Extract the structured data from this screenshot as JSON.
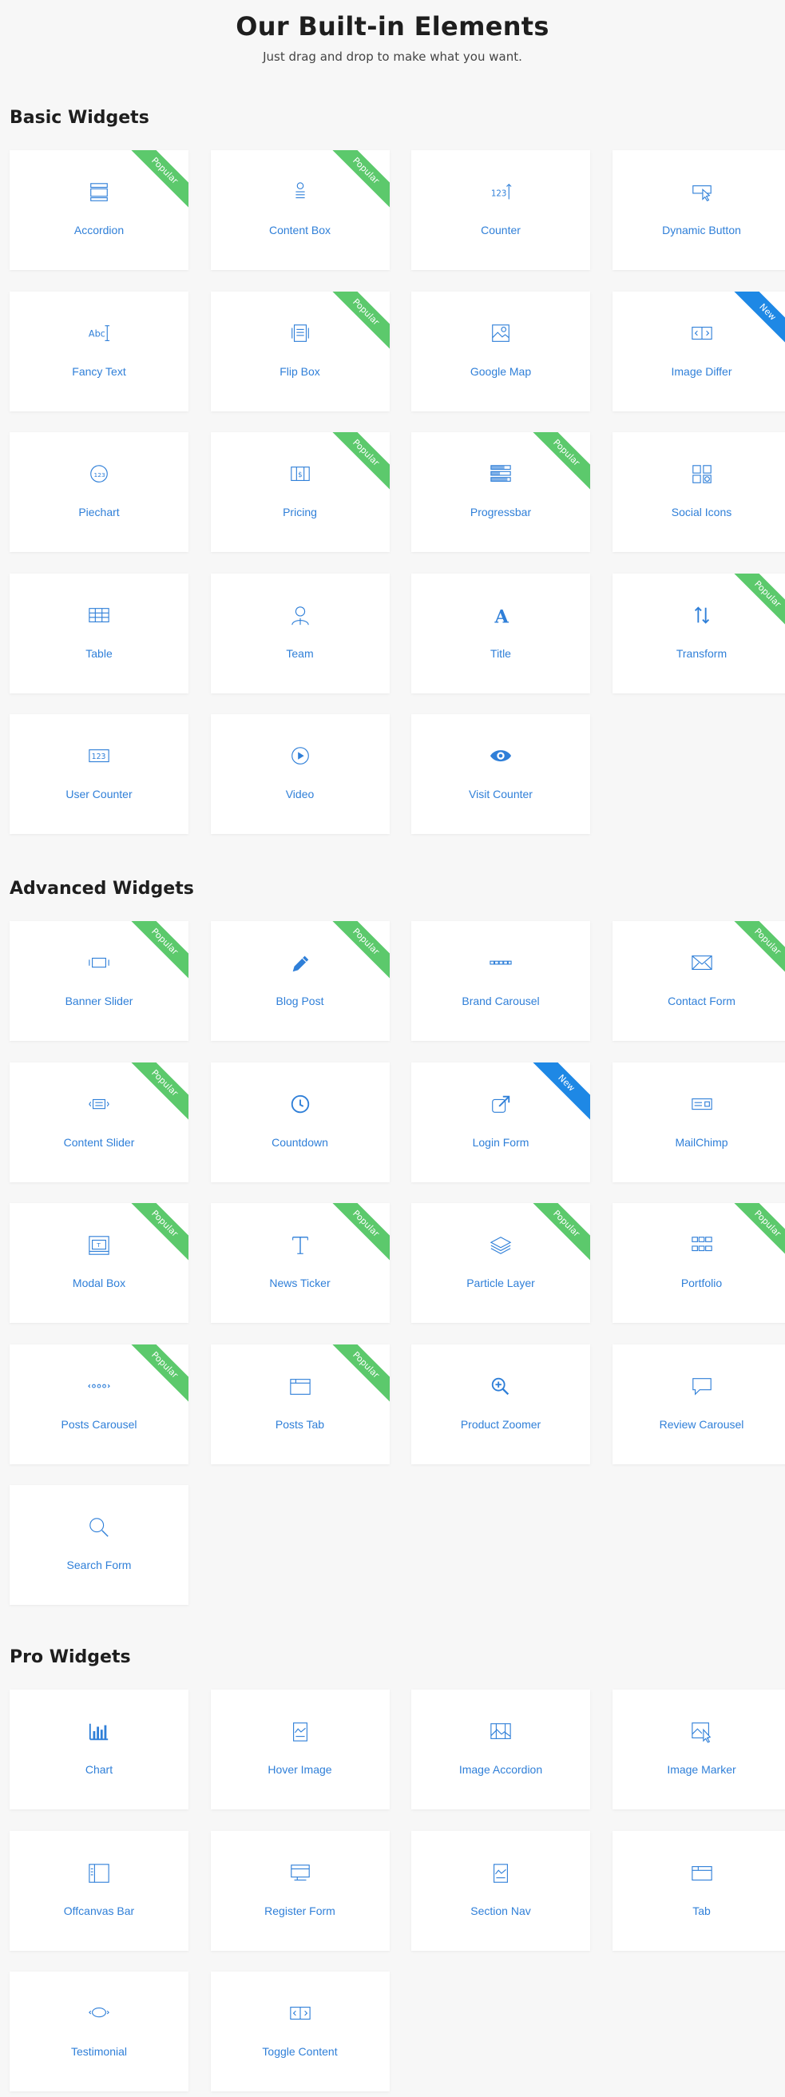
{
  "header": {
    "title": "Our Built-in Elements",
    "subtitle": "Just drag and drop to make what you want."
  },
  "colors": {
    "accent": "#2f7fd8",
    "popular": "#5cc96c",
    "new": "#1e88e5"
  },
  "sections": [
    {
      "title": "Basic Widgets",
      "items": [
        {
          "label": "Accordion",
          "icon": "accordion-icon",
          "badge": "Popular"
        },
        {
          "label": "Content Box",
          "icon": "content-box-icon",
          "badge": "Popular"
        },
        {
          "label": "Counter",
          "icon": "counter-icon",
          "badge": ""
        },
        {
          "label": "Dynamic Button",
          "icon": "dynamic-button-icon",
          "badge": ""
        },
        {
          "label": "Fancy Text",
          "icon": "fancy-text-icon",
          "badge": ""
        },
        {
          "label": "Flip Box",
          "icon": "flip-box-icon",
          "badge": "Popular"
        },
        {
          "label": "Google Map",
          "icon": "google-map-icon",
          "badge": ""
        },
        {
          "label": "Image Differ",
          "icon": "image-differ-icon",
          "badge": "New"
        },
        {
          "label": "Piechart",
          "icon": "piechart-icon",
          "badge": ""
        },
        {
          "label": "Pricing",
          "icon": "pricing-icon",
          "badge": "Popular"
        },
        {
          "label": "Progressbar",
          "icon": "progressbar-icon",
          "badge": "Popular"
        },
        {
          "label": "Social Icons",
          "icon": "social-icons-icon",
          "badge": ""
        },
        {
          "label": "Table",
          "icon": "table-icon",
          "badge": ""
        },
        {
          "label": "Team",
          "icon": "team-icon",
          "badge": ""
        },
        {
          "label": "Title",
          "icon": "title-icon",
          "badge": ""
        },
        {
          "label": "Transform",
          "icon": "transform-icon",
          "badge": "Popular"
        },
        {
          "label": "User Counter",
          "icon": "user-counter-icon",
          "badge": ""
        },
        {
          "label": "Video",
          "icon": "video-icon",
          "badge": ""
        },
        {
          "label": "Visit Counter",
          "icon": "visit-counter-icon",
          "badge": ""
        }
      ]
    },
    {
      "title": "Advanced Widgets",
      "items": [
        {
          "label": "Banner Slider",
          "icon": "banner-slider-icon",
          "badge": "Popular"
        },
        {
          "label": "Blog Post",
          "icon": "blog-post-icon",
          "badge": "Popular"
        },
        {
          "label": "Brand Carousel",
          "icon": "brand-carousel-icon",
          "badge": ""
        },
        {
          "label": "Contact Form",
          "icon": "contact-form-icon",
          "badge": "Popular"
        },
        {
          "label": "Content Slider",
          "icon": "content-slider-icon",
          "badge": "Popular"
        },
        {
          "label": "Countdown",
          "icon": "countdown-icon",
          "badge": ""
        },
        {
          "label": "Login Form",
          "icon": "login-form-icon",
          "badge": "New"
        },
        {
          "label": "MailChimp",
          "icon": "mailchimp-icon",
          "badge": ""
        },
        {
          "label": "Modal Box",
          "icon": "modal-box-icon",
          "badge": "Popular"
        },
        {
          "label": "News Ticker",
          "icon": "news-ticker-icon",
          "badge": "Popular"
        },
        {
          "label": "Particle Layer",
          "icon": "particle-layer-icon",
          "badge": "Popular"
        },
        {
          "label": "Portfolio",
          "icon": "portfolio-icon",
          "badge": "Popular"
        },
        {
          "label": "Posts Carousel",
          "icon": "posts-carousel-icon",
          "badge": "Popular"
        },
        {
          "label": "Posts Tab",
          "icon": "posts-tab-icon",
          "badge": "Popular"
        },
        {
          "label": "Product Zoomer",
          "icon": "product-zoomer-icon",
          "badge": ""
        },
        {
          "label": "Review Carousel",
          "icon": "review-carousel-icon",
          "badge": ""
        },
        {
          "label": "Search Form",
          "icon": "search-form-icon",
          "badge": ""
        }
      ]
    },
    {
      "title": "Pro Widgets",
      "items": [
        {
          "label": "Chart",
          "icon": "chart-icon",
          "badge": ""
        },
        {
          "label": "Hover Image",
          "icon": "hover-image-icon",
          "badge": ""
        },
        {
          "label": "Image Accordion",
          "icon": "image-accordion-icon",
          "badge": ""
        },
        {
          "label": "Image Marker",
          "icon": "image-marker-icon",
          "badge": ""
        },
        {
          "label": "Offcanvas Bar",
          "icon": "offcanvas-bar-icon",
          "badge": ""
        },
        {
          "label": "Register Form",
          "icon": "register-form-icon",
          "badge": ""
        },
        {
          "label": "Section Nav",
          "icon": "section-nav-icon",
          "badge": ""
        },
        {
          "label": "Tab",
          "icon": "tab-icon",
          "badge": ""
        },
        {
          "label": "Testimonial",
          "icon": "testimonial-icon",
          "badge": ""
        },
        {
          "label": "Toggle Content",
          "icon": "toggle-content-icon",
          "badge": ""
        }
      ]
    }
  ]
}
